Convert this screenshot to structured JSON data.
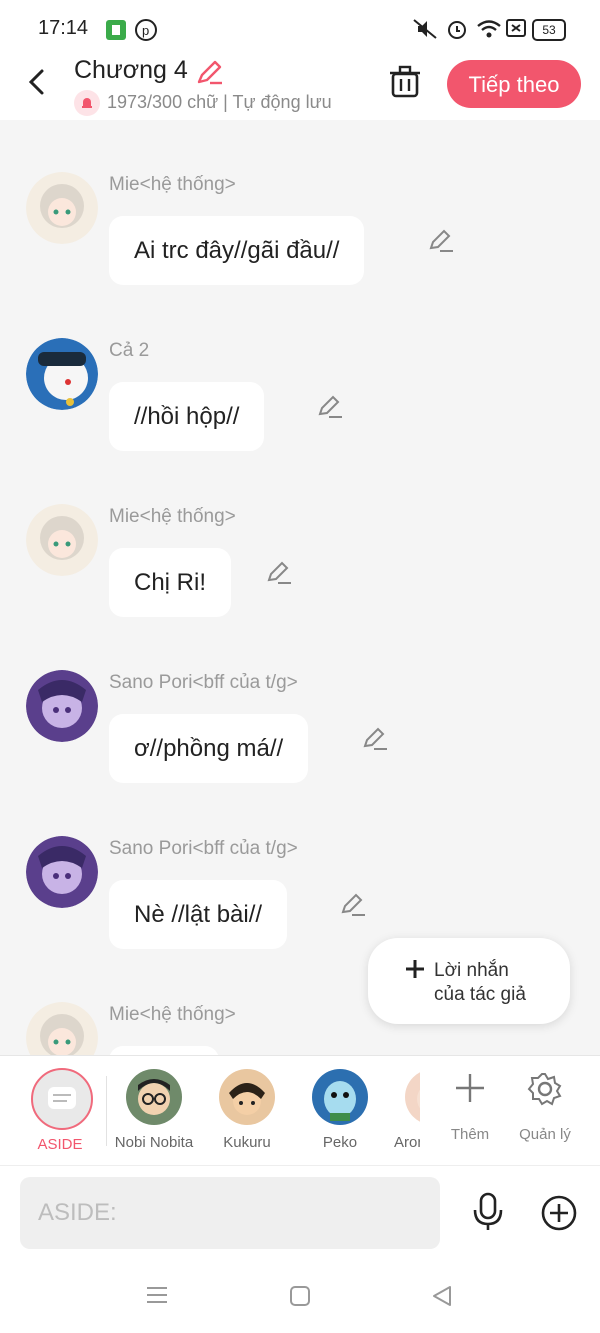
{
  "status_bar": {
    "time": "17:14",
    "battery": "53"
  },
  "header": {
    "title": "Chương 4",
    "subtitle": "1973/300 chữ | Tự động lưu",
    "next_label": "Tiếp theo"
  },
  "messages": [
    {
      "name": "Mie<hệ thống>",
      "text": "Ai trc đây//gãi đầu//"
    },
    {
      "name": "Cả 2",
      "text": "//hồi hộp//"
    },
    {
      "name": "Mie<hệ thống>",
      "text": "Chị Ri!"
    },
    {
      "name": "Sano Pori<bff của t/g>",
      "text": "ơ//phồng má//"
    },
    {
      "name": "Sano Pori<bff của t/g>",
      "text": "Nè //lật bài//"
    },
    {
      "name": "Mie<hệ thống>",
      "text": ""
    }
  ],
  "author_note": {
    "line1": "Lời nhắn",
    "line2": "của tác giả"
  },
  "characters": {
    "aside": "ASIDE",
    "items": [
      "Nobi Nobita",
      "Kukuru",
      "Peko",
      "Aron"
    ],
    "more_label": "Thêm",
    "manage_label": "Quản lý"
  },
  "composer": {
    "placeholder": "ASIDE:"
  },
  "colors": {
    "accent": "#f2566d",
    "chat_bg": "#f5f5f5"
  }
}
